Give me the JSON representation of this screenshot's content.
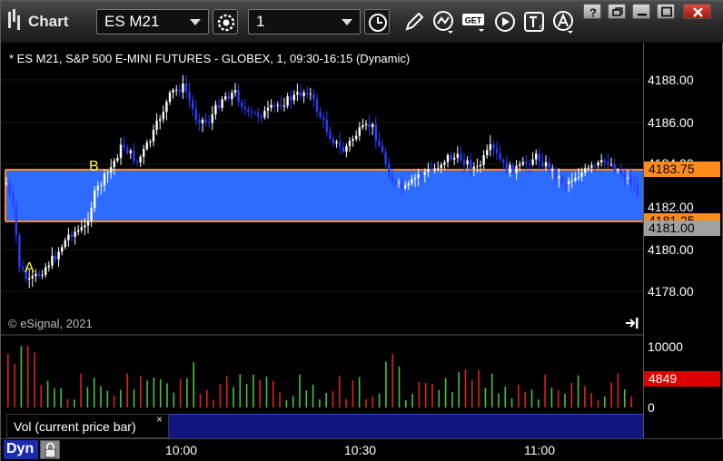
{
  "toolbar": {
    "app_title": "Chart",
    "symbol_value": "ES M21",
    "interval_value": "1"
  },
  "chart": {
    "description": "* ES M21, S&P 500 E-MINI FUTURES - GLOBEX, 1, 09:30-16:15 (Dynamic)",
    "copyright": "© eSignal, 2021",
    "label_a": "A",
    "label_b": "B",
    "price_ticks": [
      "4188.00",
      "4186.00",
      "4184.00",
      "4182.00",
      "4180.00",
      "4178.00"
    ],
    "fib_top_value": "4183.75",
    "fib_bottom_value": "4181.25",
    "last_price": "4181.00",
    "fib_color": "#ff8c1a",
    "band_color": "#2e6bff",
    "up_color": "#ffffff",
    "down_color": "#2a3cff"
  },
  "volume": {
    "title": "Vol (current price bar)",
    "close_glyph": "×",
    "ticks": [
      "10000",
      "0"
    ],
    "current_value": "4849",
    "up_color": "#45c245",
    "down_color": "#e02020"
  },
  "time_axis": {
    "labels": [
      "10:00",
      "10:30",
      "11:00"
    ]
  },
  "status": {
    "mode_label": "Dyn"
  },
  "icons": [
    "refresh-icon",
    "clock-icon",
    "pen-icon",
    "study-icon",
    "get-icon",
    "play-icon",
    "text-tool-icon",
    "alert-icon",
    "lock-icon",
    "scroll-end-icon"
  ]
}
